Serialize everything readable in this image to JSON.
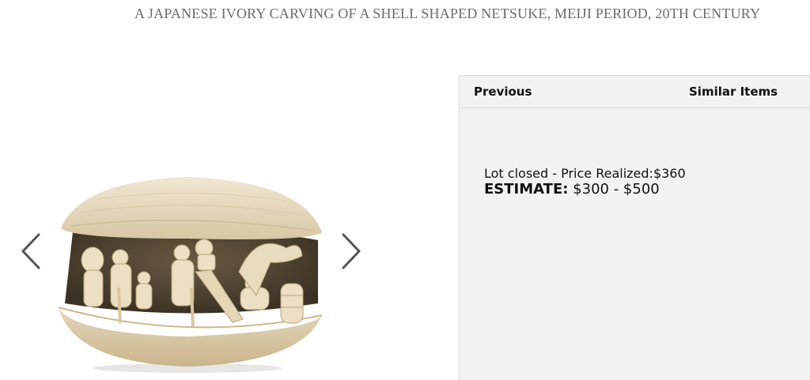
{
  "lot": {
    "title": "A JAPANESE IVORY CARVING OF A SHELL SHAPED NETSUKE, MEIJI PERIOD, 20TH CENTURY"
  },
  "gallery": {
    "prev_icon": "chevron-left-icon",
    "next_icon": "chevron-right-icon",
    "image_subject": "ivory-shell-netsuke-photo"
  },
  "panel": {
    "previous_label": "Previous",
    "similar_label": "Similar Items",
    "status_text": "Lot closed - Price Realized:$360",
    "estimate_label": "ESTIMATE:",
    "estimate_value": "$300 - $500"
  },
  "colors": {
    "title_gray": "#6b6b6b",
    "panel_bg": "#f2f2f2",
    "ivory": "#e8dcc4",
    "arrow": "#555555"
  }
}
